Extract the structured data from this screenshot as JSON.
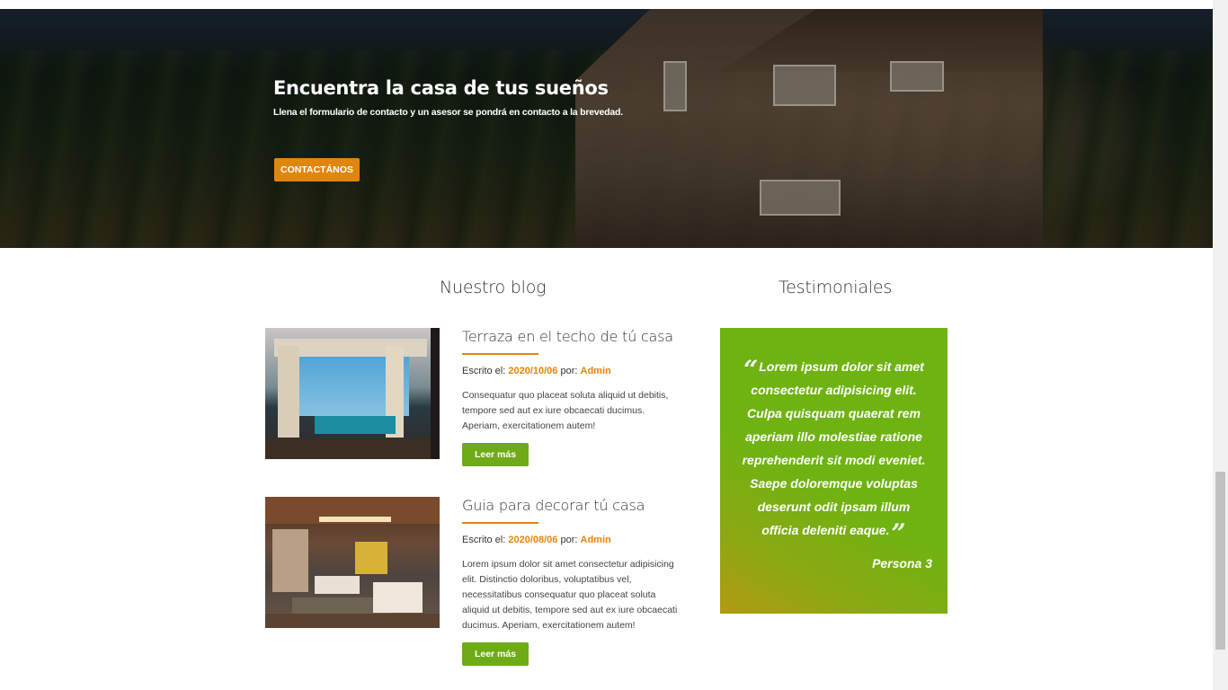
{
  "hero": {
    "title": "Encuentra la casa de tus sueños",
    "subtitle": "Llena el formulario de contacto y un asesor se pondrá en contacto a la brevedad.",
    "cta_label": "CONTACTÁNOS",
    "cta_color": "#e1860c"
  },
  "blog": {
    "heading": "Nuestro blog",
    "written_label": "Escrito el:",
    "by_label": "por:",
    "read_more_label": "Leer más",
    "posts": [
      {
        "title": "Terraza en el techo de tú casa",
        "date": "2020/10/06",
        "author": "Admin",
        "excerpt": "Consequatur quo placeat soluta aliquid ut debitis, tempore sed aut ex iure obcaecati ducimus. Aperiam, exercitationem autem!",
        "image": "rooftop-terrace-photo"
      },
      {
        "title": "Guia para decorar tú casa",
        "date": "2020/08/06",
        "author": "Admin",
        "excerpt": "Lorem ipsum dolor sit amet consectetur adipisicing elit. Distinctio doloribus, voluptatibus vel, necessitatibus consequatur quo placeat soluta aliquid ut debitis, tempore sed aut ex iure obcaecati ducimus. Aperiam, exercitationem autem!",
        "image": "living-room-photo"
      }
    ]
  },
  "testimonials": {
    "heading": "Testimoniales",
    "quote": "Lorem ipsum dolor sit amet consectetur adipisicing elit. Culpa quisquam quaerat rem aperiam illo molestiae ratione reprehenderit sit modi eveniet. Saepe doloremque voluptas deserunt odit ipsam illum officia deleniti eaque.",
    "author": "Persona 3",
    "accent_color": "#6fb312"
  }
}
